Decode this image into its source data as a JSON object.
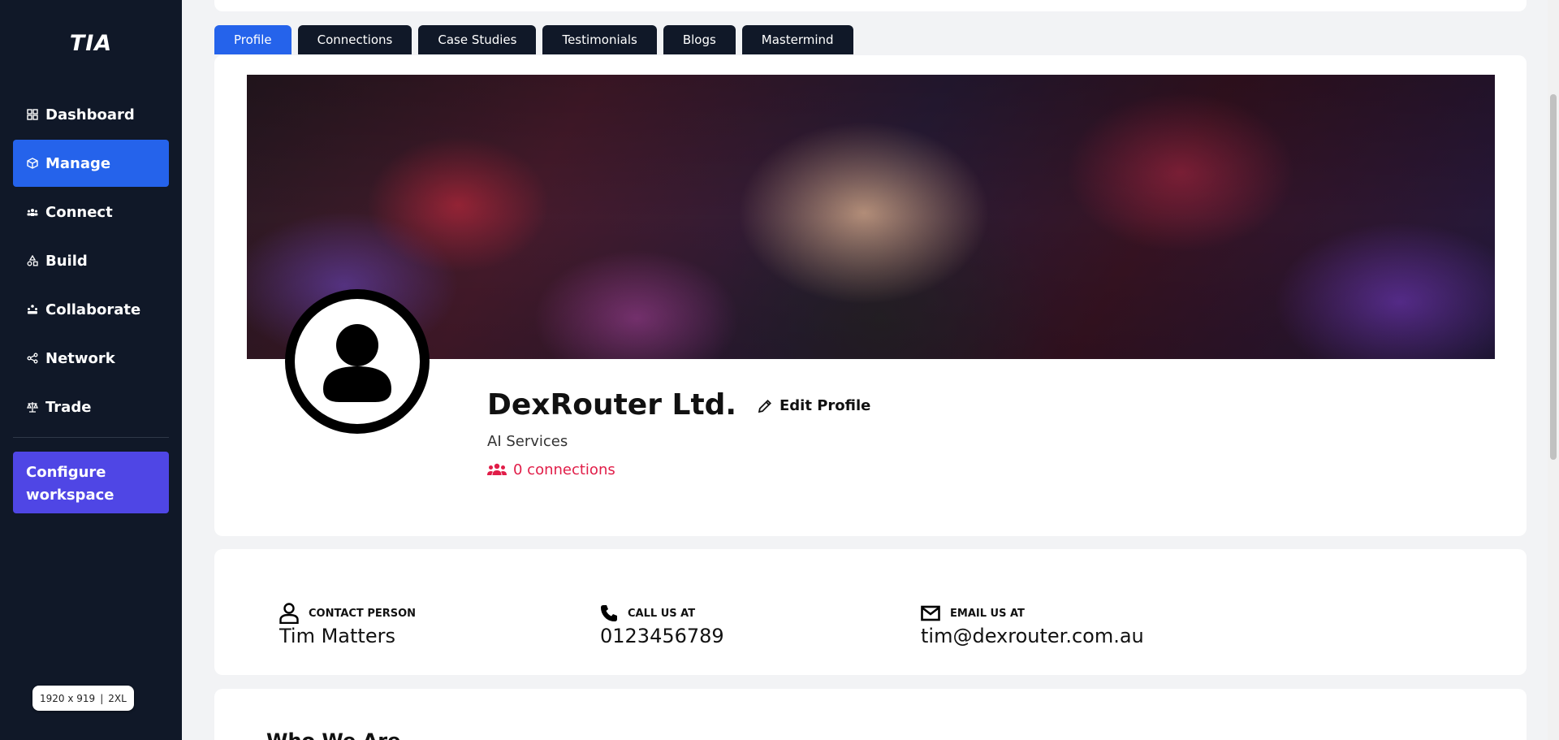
{
  "sidebar": {
    "logo": "TIA",
    "items": [
      {
        "label": "Dashboard",
        "icon": "dashboard-icon",
        "active": false
      },
      {
        "label": "Manage",
        "icon": "cube-icon",
        "active": true
      },
      {
        "label": "Connect",
        "icon": "people-icon",
        "active": false
      },
      {
        "label": "Build",
        "icon": "shapes-icon",
        "active": false
      },
      {
        "label": "Collaborate",
        "icon": "team-icon",
        "active": false
      },
      {
        "label": "Network",
        "icon": "share-icon",
        "active": false
      },
      {
        "label": "Trade",
        "icon": "scale-icon",
        "active": false
      }
    ],
    "configure_label": "Configure workspace",
    "size_badge": {
      "dims": "1920 x 919",
      "separator": "|",
      "breakpoint": "2XL"
    }
  },
  "tabs": [
    {
      "label": "Profile",
      "active": true
    },
    {
      "label": "Connections",
      "active": false
    },
    {
      "label": "Case Studies",
      "active": false
    },
    {
      "label": "Testimonials",
      "active": false
    },
    {
      "label": "Blogs",
      "active": false
    },
    {
      "label": "Mastermind",
      "active": false
    }
  ],
  "profile": {
    "company_name": "DexRouter Ltd.",
    "edit_label": "Edit Profile",
    "industry": "AI Services",
    "connections_label": "0 connections"
  },
  "contact": {
    "person_heading": "CONTACT PERSON",
    "person_value": "Tim Matters",
    "phone_heading": "CALL US AT",
    "phone_value": "0123456789",
    "email_heading": "EMAIL US AT",
    "email_value": "tim@dexrouter.com.au"
  },
  "about": {
    "title": "Who We Are"
  },
  "colors": {
    "sidebar_bg": "#101828",
    "accent": "#2563eb",
    "configure": "#4f46e5",
    "connections": "#e11d48"
  }
}
